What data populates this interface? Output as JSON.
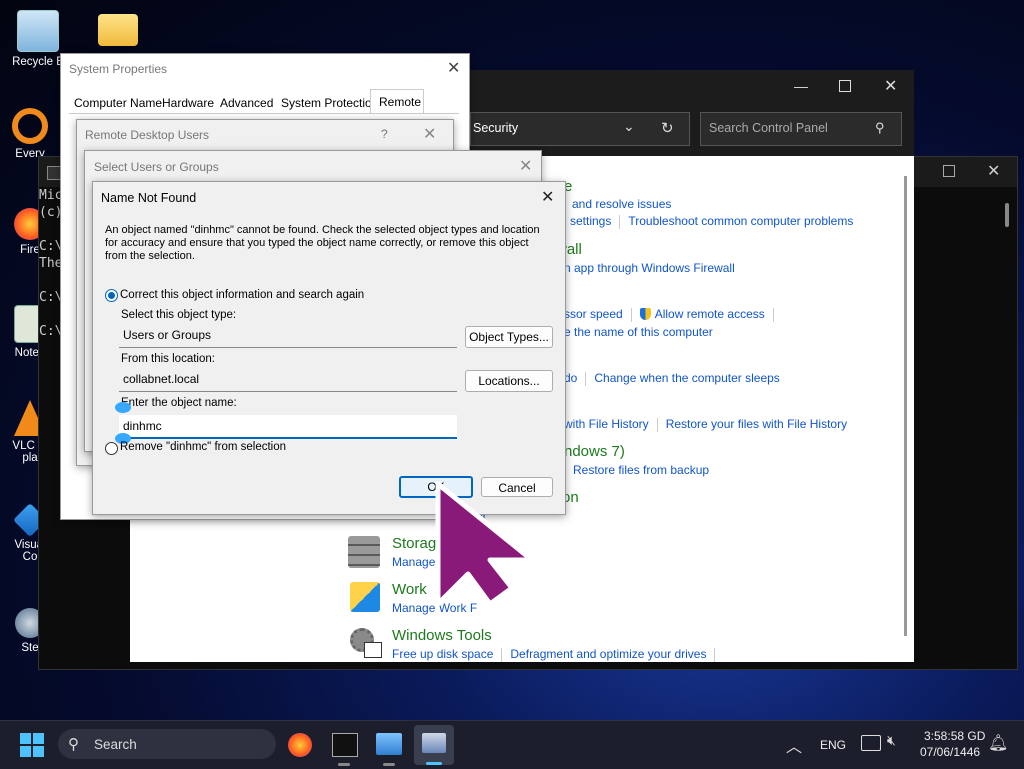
{
  "desktop": {
    "icons": [
      {
        "label": "Recycle B",
        "name": "recycle-bin-icon"
      },
      {
        "label": "Every",
        "name": "everything-icon"
      },
      {
        "label": "Fire",
        "name": "firefox-icon"
      },
      {
        "label": "Notep",
        "name": "notepad-icon"
      },
      {
        "label": "VLC m pla",
        "name": "vlc-icon"
      },
      {
        "label": "Visual Co",
        "name": "vscode-icon"
      },
      {
        "label": "Ste",
        "name": "steam-icon"
      }
    ]
  },
  "terminal": {
    "lines": [
      "Mic",
      "(c)",
      "",
      "C:\\",
      "The",
      "",
      "C:\\",
      "",
      "C:\\"
    ]
  },
  "control_panel": {
    "breadcrumb": "Security",
    "search_placeholder": "Search Control Panel",
    "rows": [
      {
        "text": "e"
      },
      {
        "links": [
          "and resolve issues"
        ]
      },
      {
        "links": [
          "l settings",
          "Troubleshoot common computer problems"
        ]
      },
      {
        "text": "wall"
      },
      {
        "links": [
          "n app through Windows Firewall"
        ]
      },
      {
        "links": [
          "ssor speed",
          "Allow remote access"
        ]
      },
      {
        "links": [
          "e the name of this computer"
        ]
      },
      {
        "links": [
          "do",
          "Change when the computer sleeps"
        ]
      },
      {
        "links": [
          "with File History",
          "Restore your files with File History"
        ]
      },
      {
        "text": "ndows 7)"
      },
      {
        "links": [
          "Restore files from backup"
        ]
      },
      {
        "text": "on"
      },
      {
        "links": [
          "ker"
        ]
      }
    ],
    "storage": {
      "title": "Storag",
      "link": "Manage"
    },
    "work_folders": {
      "title": "Work",
      "link": "Manage Work F"
    },
    "windows_tools": {
      "title": "Windows Tools",
      "links": [
        "Free up disk space",
        "Defragment and optimize your drives"
      ]
    }
  },
  "system_properties": {
    "title": "System Properties",
    "tabs": [
      "Computer Name",
      "Hardware",
      "Advanced",
      "System Protection",
      "Remote"
    ],
    "active_tab": "Remote"
  },
  "remote_desktop_users": {
    "title": "Remote Desktop Users",
    "help": "?"
  },
  "select_users": {
    "title": "Select Users or Groups"
  },
  "name_not_found": {
    "title": "Name Not Found",
    "message": "An object named \"dinhmc\" cannot be found. Check the selected object types and location for accuracy and ensure that you typed the object name correctly, or remove this object from the selection.",
    "option_correct": "Correct this object information and search again",
    "label_type": "Select this object type:",
    "value_type": "Users or Groups",
    "btn_object_types": "Object Types...",
    "label_location": "From this location:",
    "value_location": "collabnet.local",
    "btn_locations": "Locations...",
    "label_name": "Enter the object name:",
    "value_name": "dinhmc",
    "option_remove": "Remove \"dinhmc\" from selection",
    "btn_ok": "OK",
    "btn_cancel": "Cancel"
  },
  "taskbar": {
    "search_label": "Search",
    "language": "ENG",
    "time": "3:58:58 GD",
    "date": "07/06/1446"
  },
  "colors": {
    "accent": "#0067c0",
    "cursor": "#8a1a7a",
    "cp_link": "#1155cc",
    "cp_heading": "#1e7a1e"
  }
}
